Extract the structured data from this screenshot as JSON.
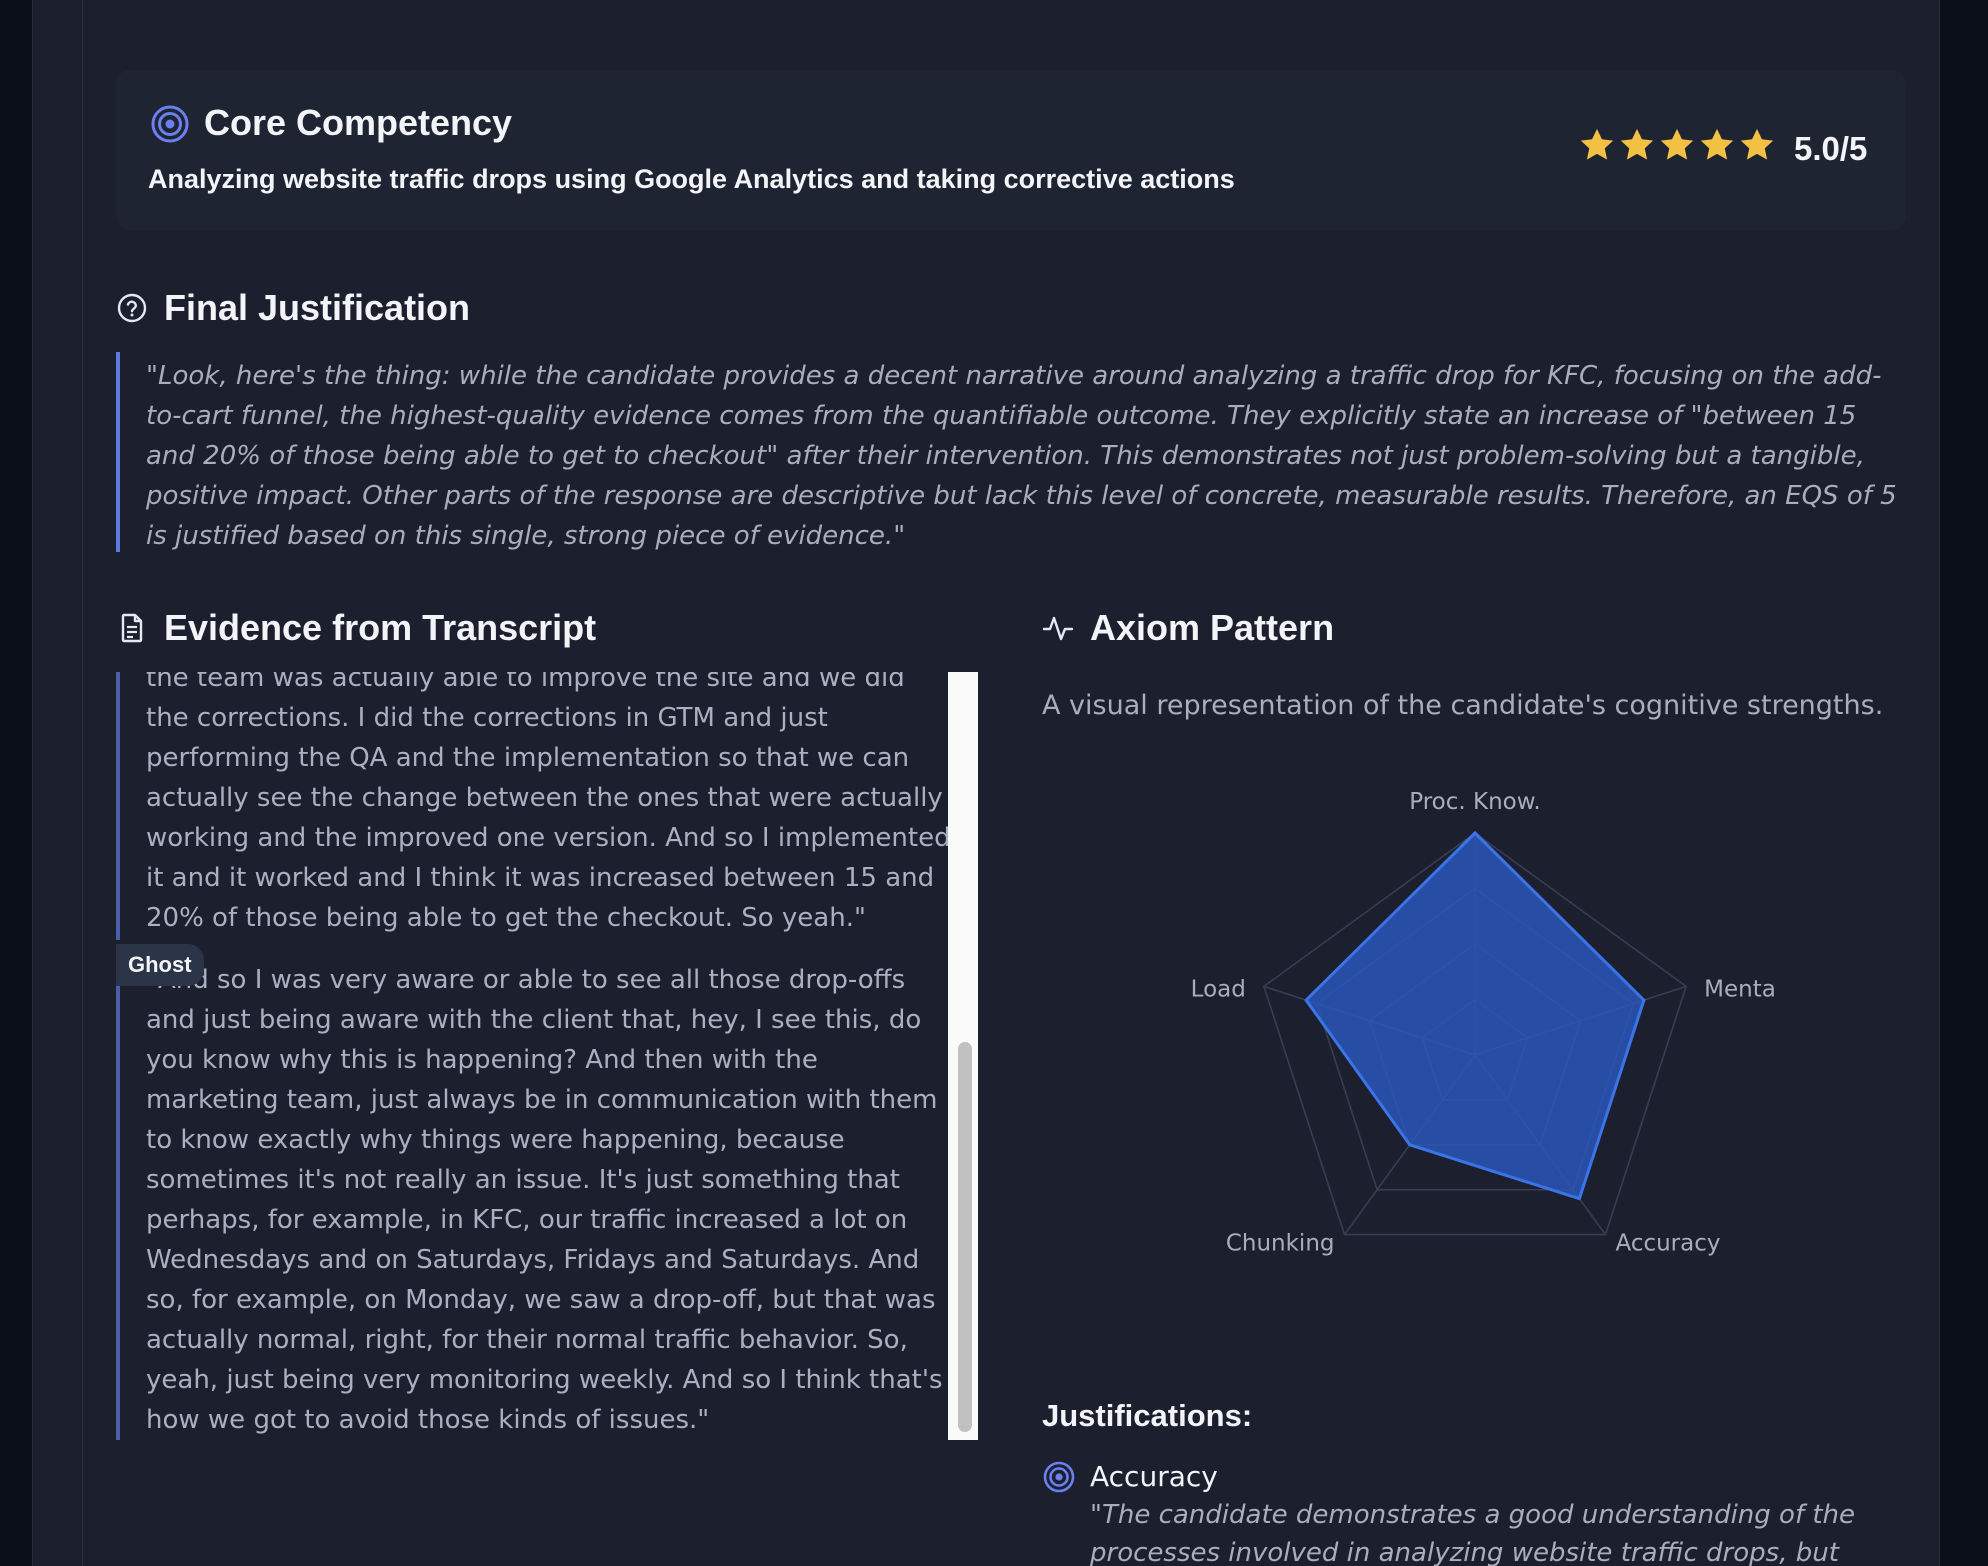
{
  "competency": {
    "title": "Core Competency",
    "subtitle": "Analyzing website traffic drops using Google Analytics and taking corrective actions",
    "rating": 5,
    "rating_max": 5,
    "score_text": "5.0/5",
    "star_color": "#f2c043"
  },
  "final_justification": {
    "title": "Final Justification",
    "text": "\"Look, here's the thing: while the candidate provides a decent narrative around analyzing a traffic drop for KFC, focusing on the add-to-cart funnel, the highest-quality evidence comes from the quantifiable outcome. They explicitly state an increase of \"between 15 and 20% of those being able to get to checkout\" after their intervention. This demonstrates not just problem-solving but a tangible, positive impact. Other parts of the response are descriptive but lack this level of concrete, measurable results. Therefore, an EQS of 5 is justified based on this single, strong piece of evidence.\""
  },
  "evidence": {
    "title": "Evidence from Transcript",
    "items": [
      {
        "text": "the team was actually able to improve the site and we did the corrections. I did the corrections in GTM and just performing the QA and the implementation so that we can actually see the change between the ones that were actually working and the improved one version. And so I implemented it and it worked and I think it was increased between 15 and 20% of those being able to get the checkout. So yeah.\""
      },
      {
        "tag": "Ghost",
        "text": "\"And so I was very aware or able to see all those drop-offs and just being aware with the client that, hey, I see this, do you know why this is happening? And then with the marketing team, just always be in communication with them to know exactly why things were happening, because sometimes it's not really an issue. It's just something that perhaps, for example, in KFC, our traffic increased a lot on Wednesdays and on Saturdays, Fridays and Saturdays. And so, for example, on Monday, we saw a drop-off, but that was actually normal, right, for their normal traffic behavior. So, yeah, just being very monitoring weekly. And so I think that's how we got to avoid those kinds of issues.\""
      }
    ]
  },
  "axiom": {
    "title": "Axiom Pattern",
    "description": "A visual representation of the candidate's cognitive strengths."
  },
  "chart_data": {
    "type": "radar",
    "categories": [
      "Proc. Know.",
      "Mental",
      "Accuracy",
      "Chunking",
      "Load"
    ],
    "visible_labels": [
      "Proc. Know.",
      "Menta",
      "Accuracy",
      "Chunking",
      "Load"
    ],
    "values": [
      5,
      4,
      4,
      2.5,
      4
    ],
    "rmax": 5,
    "rings": 4,
    "fill_color": "#2a56b8",
    "stroke_color": "#3b74e8",
    "grid_color": "#373d52"
  },
  "justifications": {
    "title": "Justifications:",
    "items": [
      {
        "name": "Accuracy",
        "text": "\"The candidate demonstrates a good understanding of the processes involved in analyzing website traffic drops, but"
      }
    ]
  }
}
